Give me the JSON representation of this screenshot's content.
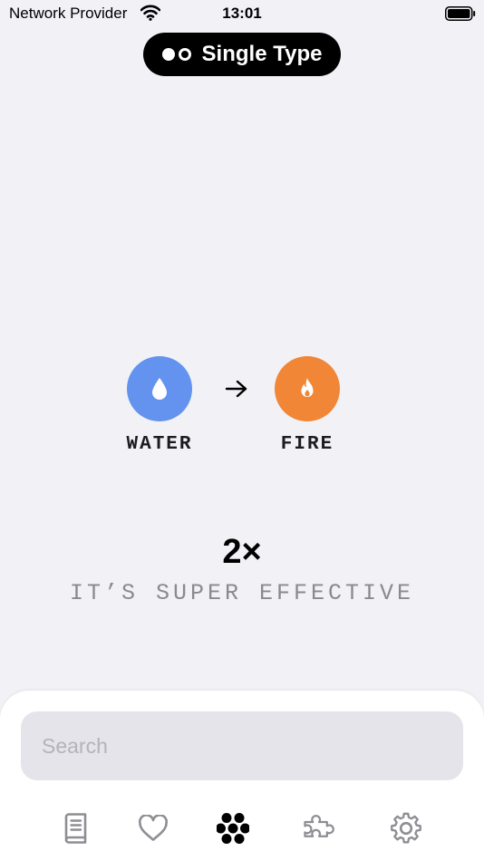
{
  "status_bar": {
    "carrier": "Network Provider",
    "time": "13:01",
    "wifi_icon": "wifi-icon",
    "battery_icon": "battery-icon"
  },
  "mode": {
    "label": "Single Type",
    "icon": "type-dots-icon"
  },
  "matchup": {
    "attacker": {
      "name": "WATER",
      "icon": "water-drop-icon",
      "color": "#6393ef"
    },
    "defender": {
      "name": "FIRE",
      "icon": "flame-icon",
      "color": "#f08636"
    },
    "arrow_icon": "arrow-right-icon",
    "multiplier": "2×",
    "effectiveness": "IT’S SUPER EFFECTIVE"
  },
  "search": {
    "placeholder": "Search",
    "value": ""
  },
  "tabs": [
    {
      "icon": "book-icon"
    },
    {
      "icon": "heart-icon"
    },
    {
      "icon": "type-chart-icon",
      "selected": true
    },
    {
      "icon": "puzzle-icon"
    },
    {
      "icon": "gear-icon"
    }
  ]
}
